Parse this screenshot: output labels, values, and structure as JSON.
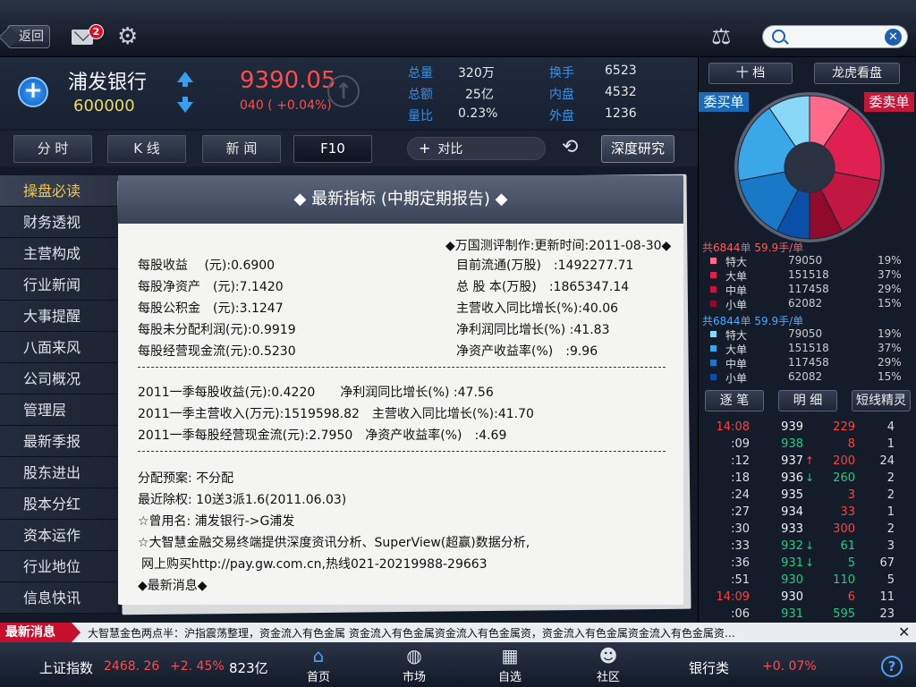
{
  "topbar": {
    "back_label": "返回",
    "mail_badge": "2",
    "search_placeholder": ""
  },
  "stock": {
    "name": "浦发银行",
    "code": "600000",
    "price": "9390.05",
    "change": "040 ( +0.04%)",
    "stats": [
      {
        "label": "总量",
        "value": "320万"
      },
      {
        "label": "总额",
        "value": "25亿"
      },
      {
        "label": "量比",
        "value": "0.23%"
      },
      {
        "label": "换手",
        "value": "6523"
      },
      {
        "label": "内盘",
        "value": "4532"
      },
      {
        "label": "外盘",
        "value": "1236"
      }
    ]
  },
  "tabs": {
    "fenshi": "分 时",
    "kline": "K 线",
    "news": "新 闻",
    "f10": "F10",
    "compare": "对比",
    "deep": "深度研究"
  },
  "menu": [
    "操盘必读",
    "财务透视",
    "主营构成",
    "行业新闻",
    "大事提醒",
    "八面来风",
    "公司概况",
    "管理层",
    "最新季报",
    "股东进出",
    "股本分红",
    "资本运作",
    "行业地位",
    "信息快讯"
  ],
  "content": {
    "title": "◆ 最新指标 (中期定期报告) ◆",
    "update": "◆万国测评制作:更新时间:2011-08-30◆",
    "left": [
      "每股收益　 (元):0.6900",
      "每股净资产　(元):7.1420",
      "每股公积金　(元):3.1247",
      "每股未分配利润(元):0.9919",
      "每股经营现金流(元):0.5230"
    ],
    "right": [
      "目前流通(万股)　:1492277.71",
      "总 股 本(万股)　:1865347.14",
      "主营收入同比增长(%):40.06",
      "净利润同比增长(%) :41.83",
      "净资产收益率(%)　:9.96"
    ],
    "q1": [
      "2011一季每股收益(元):0.4220　　净利润同比增长(%) :47.56",
      "2011一季主营收入(万元):1519598.82　主营收入同比增长(%):41.70",
      "2011一季每股经营现金流(元):2.7950　净资产收益率(%)　:4.69"
    ],
    "misc": [
      "分配预案: 不分配",
      "最近除权: 10送3派1.6(2011.06.03)",
      "☆曾用名: 浦发银行->G浦发",
      "☆大智慧金融交易终端提供深度资讯分析、SuperView(超赢)数据分析,",
      "网上购买http://pay.gw.com.cn,热线021-20219988-29663",
      "◆最新消息◆"
    ]
  },
  "right": {
    "tab_10": "十 档",
    "tab_dragon": "龙虎看盘",
    "buy": "委买单",
    "sell": "委卖单",
    "colors": {
      "buy_dark": "#0a4fa8",
      "buy_light": "#5bc0e8",
      "sell_dark": "#9a0a30",
      "sell_light": "#f06080"
    },
    "pie": {
      "buy": [
        19,
        37,
        29,
        15
      ],
      "sell": [
        19,
        37,
        29,
        15
      ]
    },
    "sell_head": "共6844单  59.9手/单",
    "sell_rows": [
      {
        "name": "特大",
        "num": "79050",
        "pct": "19%"
      },
      {
        "name": "大单",
        "num": "151518",
        "pct": "37%"
      },
      {
        "name": "中单",
        "num": "117458",
        "pct": "29%"
      },
      {
        "name": "小单",
        "num": "62082",
        "pct": "15%"
      }
    ],
    "buy_head": "共6844单  59.9手/单",
    "buy_rows": [
      {
        "name": "特大",
        "num": "79050",
        "pct": "19%"
      },
      {
        "name": "大单",
        "num": "151518",
        "pct": "37%"
      },
      {
        "name": "中单",
        "num": "117458",
        "pct": "29%"
      },
      {
        "name": "小单",
        "num": "62082",
        "pct": "15%"
      }
    ],
    "tab_tick": "逐 笔",
    "tab_detail": "明 细",
    "tab_short": "短线精灵",
    "ticks": [
      {
        "time": "14:08",
        "price": "939",
        "pc": "w",
        "arrow": "",
        "vol": "229",
        "vc": "r",
        "n": "4"
      },
      {
        "time": ":09",
        "price": "938",
        "pc": "g",
        "arrow": "",
        "vol": "8",
        "vc": "r",
        "n": "1"
      },
      {
        "time": ":12",
        "price": "937",
        "pc": "w",
        "arrow": "↑",
        "ac": "r",
        "vol": "200",
        "vc": "r",
        "n": "24"
      },
      {
        "time": ":18",
        "price": "936",
        "pc": "w",
        "arrow": "↓",
        "ac": "g",
        "vol": "260",
        "vc": "g",
        "n": "2"
      },
      {
        "time": ":24",
        "price": "935",
        "pc": "w",
        "arrow": "",
        "vol": "3",
        "vc": "r",
        "n": "2"
      },
      {
        "time": ":27",
        "price": "934",
        "pc": "w",
        "arrow": "",
        "vol": "33",
        "vc": "r",
        "n": "1"
      },
      {
        "time": ":30",
        "price": "933",
        "pc": "w",
        "arrow": "",
        "vol": "300",
        "vc": "r",
        "n": "2"
      },
      {
        "time": ":33",
        "price": "932",
        "pc": "g",
        "arrow": "↓",
        "ac": "g",
        "vol": "61",
        "vc": "g",
        "n": "3"
      },
      {
        "time": ":36",
        "price": "931",
        "pc": "g",
        "arrow": "↓",
        "ac": "g",
        "vol": "5",
        "vc": "g",
        "n": "67"
      },
      {
        "time": ":51",
        "price": "930",
        "pc": "g",
        "arrow": "",
        "vol": "110",
        "vc": "g",
        "n": "5"
      },
      {
        "time": "14:09",
        "price": "930",
        "pc": "w",
        "arrow": "",
        "vol": "6",
        "vc": "r",
        "n": "11"
      },
      {
        "time": ":06",
        "price": "931",
        "pc": "g",
        "arrow": "",
        "vol": "595",
        "vc": "g",
        "n": "23"
      }
    ]
  },
  "news": {
    "label": "最新消息",
    "text": "大智慧金色两点半：沪指震荡整理，资金流入有色金属 资金流入有色金属资金流入有色金属资，资金流入有色金属资金流入有色金属资…"
  },
  "bottom": {
    "index_name": "上证指数",
    "index_value": "2468. 26",
    "index_change": "+2. 45%",
    "index_amount": "823亿",
    "nav": [
      "首页",
      "市场",
      "自选",
      "社区"
    ],
    "sector_name": "银行类",
    "sector_change": "+0. 07%"
  }
}
